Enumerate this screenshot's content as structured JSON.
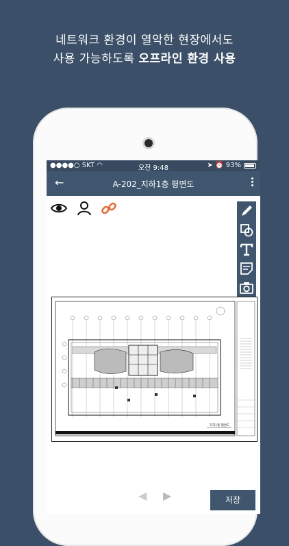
{
  "headline": {
    "line1": "네트워크 환경이 열악한 현장에서도",
    "line2_normal": "사용 가능하도록 ",
    "line2_bold": "오프라인 환경 사용"
  },
  "status": {
    "carrier": "●●●●○ SKT",
    "time": "오전 9:48",
    "battery": "93%",
    "battery_level": 0.93
  },
  "appbar": {
    "title": "A-202_지하1층 평면도"
  },
  "drawing": {
    "title": "지하1층 평면도"
  },
  "buttons": {
    "save": "저장"
  },
  "colors": {
    "background": "#3b5068",
    "bar": "#3f566e",
    "link_icon": "#e0713a"
  }
}
